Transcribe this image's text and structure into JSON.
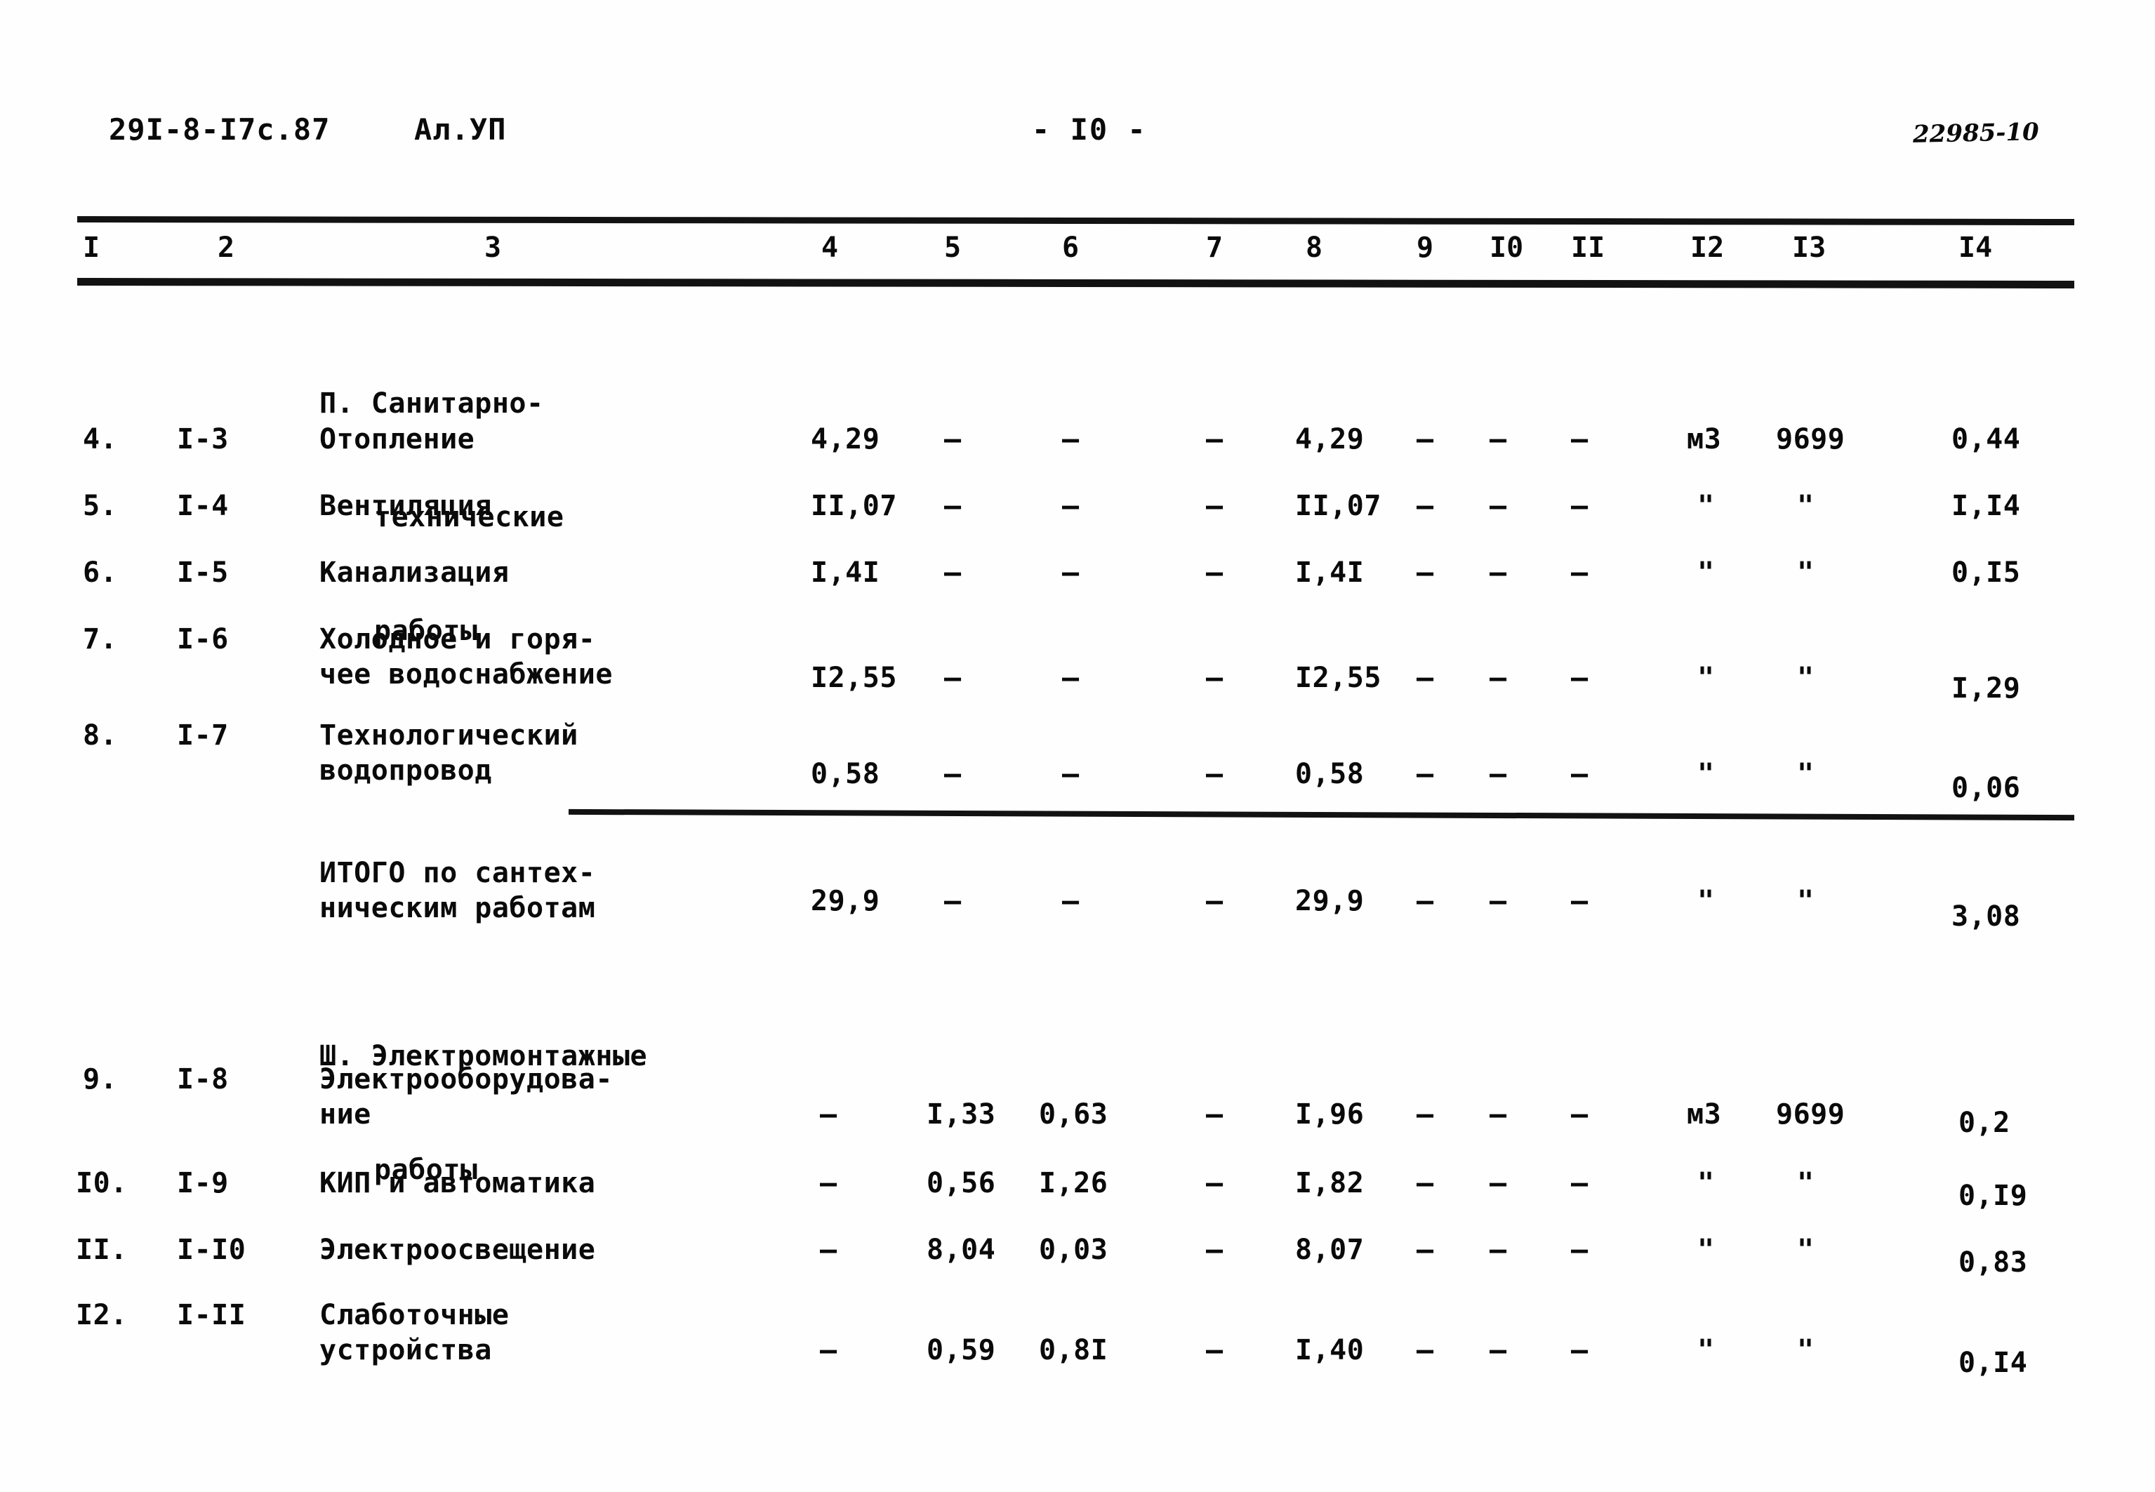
{
  "header": {
    "doc_code": "29I-8-I7c.87",
    "album": "Ал.УП",
    "page_number": "- I0 -",
    "stamp_number": "22985-10"
  },
  "table": {
    "column_headers": [
      "I",
      "2",
      "3",
      "4",
      "5",
      "6",
      "7",
      "8",
      "9",
      "I0",
      "II",
      "I2",
      "I3",
      "I4"
    ],
    "sections": [
      {
        "title_line1": "П. Санитарно-",
        "title_line2": "технические",
        "title_line3": "работы"
      },
      {
        "title_line1": "Ш. Электромонтажные",
        "title_line2": "работы",
        "title_line3": ""
      }
    ],
    "rows": [
      {
        "c1": "4.",
        "c2": "I-3",
        "name1": "Отопление",
        "name2": "",
        "c4": "4,29",
        "c5": "–",
        "c6": "–",
        "c7": "–",
        "c8": "4,29",
        "c9": "–",
        "c10": "–",
        "c11": "–",
        "c12": "м3",
        "c13": "9699",
        "c14": "0,44"
      },
      {
        "c1": "5.",
        "c2": "I-4",
        "name1": "Вентиляция",
        "name2": "",
        "c4": "II,07",
        "c5": "–",
        "c6": "–",
        "c7": "–",
        "c8": "II,07",
        "c9": "–",
        "c10": "–",
        "c11": "–",
        "c12": "\"",
        "c13": "\"",
        "c14": "I,I4"
      },
      {
        "c1": "6.",
        "c2": "I-5",
        "name1": "Канализация",
        "name2": "",
        "c4": "I,4I",
        "c5": "–",
        "c6": "–",
        "c7": "–",
        "c8": "I,4I",
        "c9": "–",
        "c10": "–",
        "c11": "–",
        "c12": "\"",
        "c13": "\"",
        "c14": "0,I5"
      },
      {
        "c1": "7.",
        "c2": "I-6",
        "name1": "Холодное и горя-",
        "name2": "чее водоснабжение",
        "c4": "I2,55",
        "c5": "–",
        "c6": "–",
        "c7": "–",
        "c8": "I2,55",
        "c9": "–",
        "c10": "–",
        "c11": "–",
        "c12": "\"",
        "c13": "\"",
        "c14": "I,29"
      },
      {
        "c1": "8.",
        "c2": "I-7",
        "name1": "Технологический",
        "name2": "водопровод",
        "c4": "0,58",
        "c5": "–",
        "c6": "–",
        "c7": "–",
        "c8": "0,58",
        "c9": "–",
        "c10": "–",
        "c11": "–",
        "c12": "\"",
        "c13": "\"",
        "c14": "0,06"
      },
      {
        "c1": "",
        "c2": "",
        "name1": "ИТОГО по сантех-",
        "name2": "ническим работам",
        "c4": "29,9",
        "c5": "–",
        "c6": "–",
        "c7": "–",
        "c8": "29,9",
        "c9": "–",
        "c10": "–",
        "c11": "–",
        "c12": "\"",
        "c13": "\"",
        "c14": "3,08"
      },
      {
        "c1": "9.",
        "c2": "I-8",
        "name1": "Электрооборудова-",
        "name2": "ние",
        "c4": "–",
        "c5": "I,33",
        "c6": "0,63",
        "c7": "–",
        "c8": "I,96",
        "c9": "–",
        "c10": "–",
        "c11": "–",
        "c12": "м3",
        "c13": "9699",
        "c14": "0,2"
      },
      {
        "c1": "I0.",
        "c2": "I-9",
        "name1": "КИП и автоматика",
        "name2": "",
        "c4": "–",
        "c5": "0,56",
        "c6": "I,26",
        "c7": "–",
        "c8": "I,82",
        "c9": "–",
        "c10": "–",
        "c11": "–",
        "c12": "\"",
        "c13": "\"",
        "c14": "0,I9"
      },
      {
        "c1": "II.",
        "c2": "I-I0",
        "name1": "Электроосвещение",
        "name2": "",
        "c4": "–",
        "c5": "8,04",
        "c6": "0,03",
        "c7": "–",
        "c8": "8,07",
        "c9": "–",
        "c10": "–",
        "c11": "–",
        "c12": "\"",
        "c13": "\"",
        "c14": "0,83"
      },
      {
        "c1": "I2.",
        "c2": "I-II",
        "name1": "Слаботочные",
        "name2": "устройства",
        "c4": "–",
        "c5": "0,59",
        "c6": "0,8I",
        "c7": "–",
        "c8": "I,40",
        "c9": "–",
        "c10": "–",
        "c11": "–",
        "c12": "\"",
        "c13": "\"",
        "c14": "0,I4"
      }
    ]
  }
}
